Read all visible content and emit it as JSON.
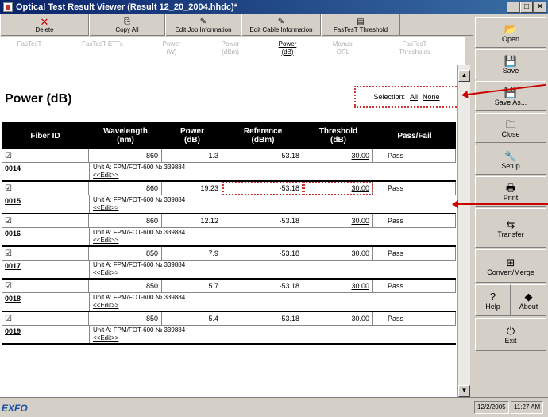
{
  "window": {
    "title": "Optical Test Result Viewer (Result 12_20_2004.hhdc)*",
    "controls": [
      "_",
      "□",
      "×"
    ]
  },
  "toolbar": {
    "delete": "Delete",
    "copy_all": "Copy All",
    "edit_job": "Edit Job Information",
    "edit_cable": "Edit Cable Information",
    "fastest_threshold": "FasTesT Threshold"
  },
  "tabs": [
    {
      "label": "FasTesT",
      "active": false
    },
    {
      "label": "FasTesT ETTx",
      "active": false
    },
    {
      "label": "Power\n(W)",
      "active": false
    },
    {
      "label": "Power\n(dBm)",
      "active": false
    },
    {
      "label": "Power\n(dB)",
      "active": true
    },
    {
      "label": "Manual\nORL",
      "active": false
    },
    {
      "label": "FasTesT\nThresholds",
      "active": false
    }
  ],
  "main": {
    "heading": "Power (dB)",
    "selection_label": "Selection:",
    "select_all": "All",
    "select_none": "None"
  },
  "table": {
    "columns": [
      "Fiber ID",
      "Wavelength\n(nm)",
      "Power\n(dB)",
      "Reference\n(dBm)",
      "Threshold\n(dB)",
      "Pass/Fail"
    ],
    "rows": [
      {
        "checked": "☑",
        "id": "0014",
        "wavelength": "860",
        "power": "1.3",
        "reference": "-53.18",
        "threshold": "30.00",
        "result": "Pass",
        "unit": "Unit A: FPM/FOT-600 № 339884",
        "edit": "<<Edit>>"
      },
      {
        "checked": "☑",
        "id": "0015",
        "wavelength": "860",
        "power": "19.23",
        "reference": "-53.18",
        "threshold": "30.00",
        "result": "Pass",
        "unit": "Unit A: FPM/FOT-600 № 339884",
        "edit": "<<Edit>>"
      },
      {
        "checked": "☑",
        "id": "0016",
        "wavelength": "860",
        "power": "12.12",
        "reference": "-53.18",
        "threshold": "30.00",
        "result": "Pass",
        "unit": "Unit A: FPM/FOT-600 № 339884",
        "edit": "<<Edit>>"
      },
      {
        "checked": "☑",
        "id": "0017",
        "wavelength": "850",
        "power": "7.9",
        "reference": "-53.18",
        "threshold": "30.00",
        "result": "Pass",
        "unit": "Unit A: FPM/FOT-600 № 339884",
        "edit": "<<Edit>>"
      },
      {
        "checked": "☑",
        "id": "0018",
        "wavelength": "850",
        "power": "5.7",
        "reference": "-53.18",
        "threshold": "30.00",
        "result": "Pass",
        "unit": "Unit A: FPM/FOT-600 № 339884",
        "edit": "<<Edit>>"
      },
      {
        "checked": "☑",
        "id": "0019",
        "wavelength": "850",
        "power": "5.4",
        "reference": "-53.18",
        "threshold": "30.00",
        "result": "Pass",
        "unit": "Unit A: FPM/FOT-600 № 339884",
        "edit": "<<Edit>>"
      }
    ]
  },
  "sidebar": {
    "open": "Open",
    "save": "Save",
    "save_as": "Save As...",
    "close": "Close",
    "setup": "Setup",
    "print": "Print",
    "transfer": "Transfer",
    "convert_merge": "Convert/Merge",
    "help": "Help",
    "about": "About",
    "exit": "Exit"
  },
  "status": {
    "brand": "EXFO",
    "date": "12/2/2005",
    "time": "11:27 AM"
  },
  "colors": {
    "annotation": "#c00000",
    "title_bar": "#0a246a",
    "header_bg": "#000000"
  }
}
